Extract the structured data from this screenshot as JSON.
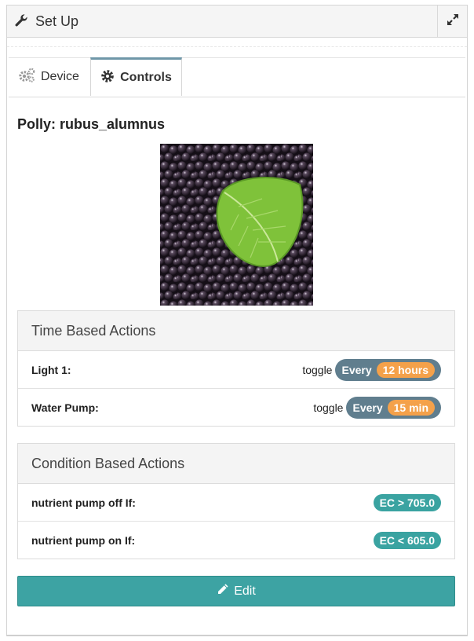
{
  "window": {
    "title": "Set Up",
    "title_icon": "wrench-icon",
    "expand_icon": "expand-icon"
  },
  "tabs": [
    {
      "label": "Device",
      "icon": "gears-icon",
      "active": false
    },
    {
      "label": "Controls",
      "icon": "gear-icon",
      "active": true
    }
  ],
  "plant": {
    "heading": "Polly: rubus_alumnus",
    "image": "blackberries with green leaf"
  },
  "time_actions": {
    "title": "Time Based Actions",
    "rows": [
      {
        "label": "Light 1:",
        "verb": "toggle",
        "every": "Every",
        "interval": "12 hours"
      },
      {
        "label": "Water Pump:",
        "verb": "toggle",
        "every": "Every",
        "interval": "15 min"
      }
    ]
  },
  "condition_actions": {
    "title": "Condition Based Actions",
    "rows": [
      {
        "label": "nutrient pump off If:",
        "condition": "EC > 705.0"
      },
      {
        "label": "nutrient pump on If:",
        "condition": "EC < 605.0"
      }
    ]
  },
  "edit": {
    "label": "Edit",
    "icon": "pencil-icon"
  },
  "colors": {
    "active_tab": "#6f97a8",
    "schedule_badge": "#607e8e",
    "interval_badge": "#f4a14a",
    "condition_badge": "#3aa3a1",
    "edit_button": "#3da3a3"
  }
}
